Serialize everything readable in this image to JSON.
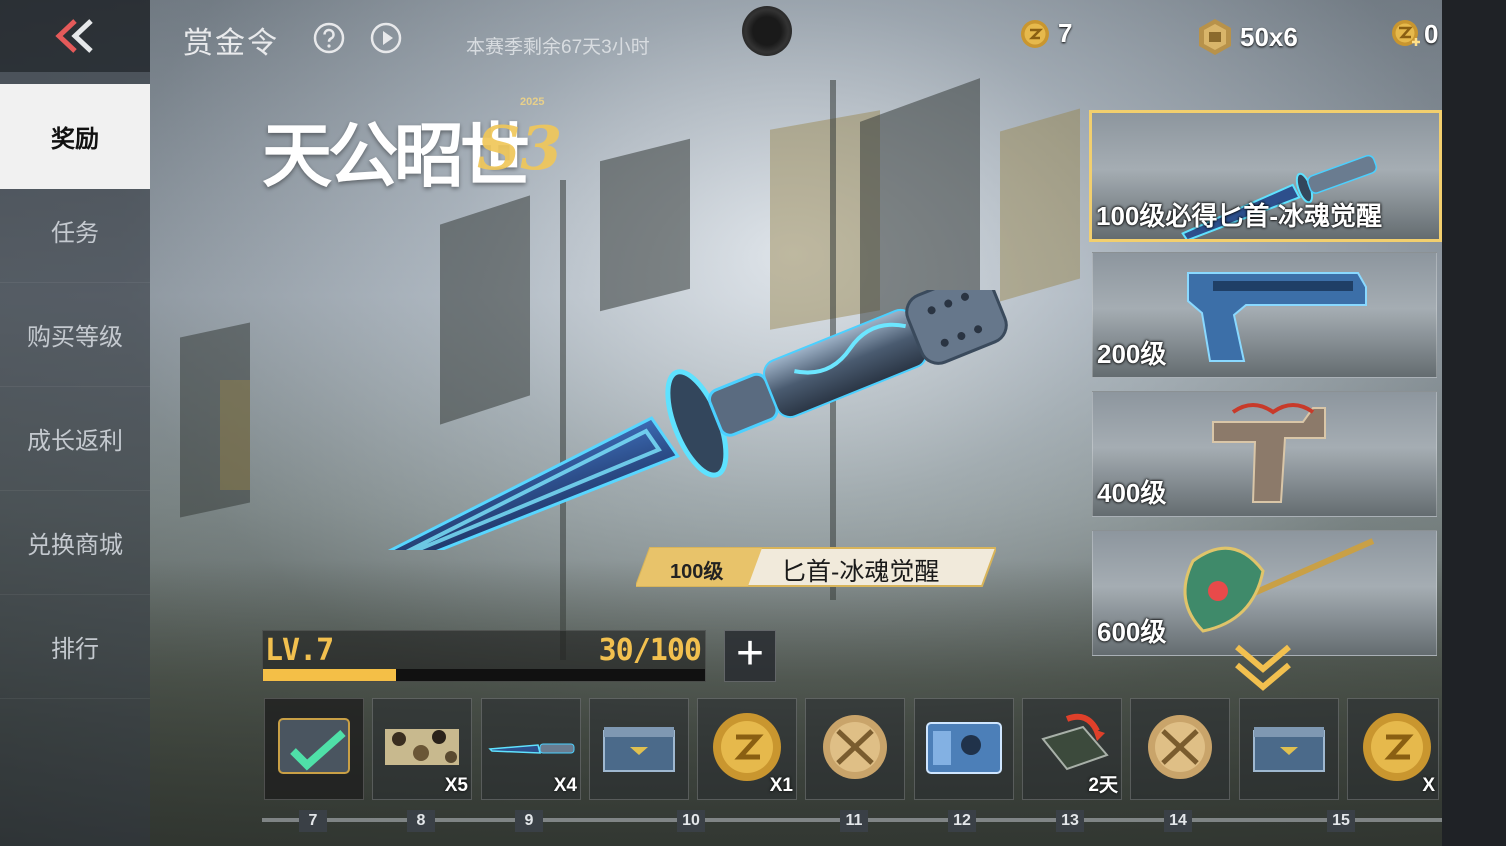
{
  "topbar": {
    "title": "赏金令",
    "season_remaining": "本赛季剩余67天3小时"
  },
  "currencies": [
    {
      "icon": "gold-coin-icon",
      "value": "7"
    },
    {
      "icon": "bronze-medal-icon",
      "value": "50x6"
    },
    {
      "icon": "gold-ticket-icon",
      "value": "0"
    }
  ],
  "sidebar": {
    "items": [
      {
        "label": "奖励",
        "active": true
      },
      {
        "label": "任务",
        "active": false
      },
      {
        "label": "购买等级",
        "active": false
      },
      {
        "label": "成长返利",
        "active": false
      },
      {
        "label": "兑换商城",
        "active": false
      },
      {
        "label": "排行",
        "active": false
      }
    ]
  },
  "logo": {
    "text": "天公昭世",
    "year": "2025",
    "season": "S3"
  },
  "featured": {
    "level": "100级",
    "name": "匕首-冰魂觉醒"
  },
  "level_bar": {
    "label": "LV.7",
    "progress": "30/100",
    "fraction": 0.3
  },
  "reward_cards": [
    {
      "label": "100级必得匕首-冰魂觉醒",
      "selected": true,
      "icon": "blue-dagger-icon"
    },
    {
      "label": "200级",
      "selected": false,
      "icon": "blue-pistol-icon"
    },
    {
      "label": "400级",
      "selected": false,
      "icon": "dragon-smg-icon"
    },
    {
      "label": "600级",
      "selected": false,
      "icon": "jade-axe-icon"
    }
  ],
  "track": {
    "slots": [
      {
        "icon": "claimed-card-icon",
        "qty": ""
      },
      {
        "icon": "camo-pattern-icon",
        "qty": "X5"
      },
      {
        "icon": "small-dagger-icon",
        "qty": "X4"
      },
      {
        "icon": "supply-crate-icon",
        "qty": ""
      },
      {
        "icon": "gold-coin-icon",
        "qty": "X1"
      },
      {
        "icon": "crossed-rifles-medal-icon",
        "qty": ""
      },
      {
        "icon": "blue-card-icon",
        "qty": ""
      },
      {
        "icon": "exp-card-icon",
        "qty": "2天"
      },
      {
        "icon": "crossed-rifles-medal-icon",
        "qty": ""
      },
      {
        "icon": "supply-crate-icon",
        "qty": ""
      },
      {
        "icon": "gold-coin-icon",
        "qty": "X"
      }
    ],
    "levels": [
      "7",
      "8",
      "9",
      "10",
      "11",
      "12",
      "13",
      "14",
      "15"
    ]
  },
  "colors": {
    "accent_gold": "#f2c04f",
    "active_tab_bg": "#f1f1f1",
    "selected_border": "#f2cf6e"
  }
}
